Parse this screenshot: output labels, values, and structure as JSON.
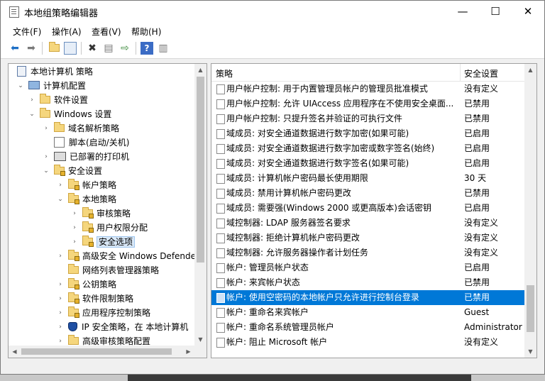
{
  "window": {
    "title": "本地组策略编辑器",
    "minimize": "—",
    "maximize": "☐",
    "close": "✕"
  },
  "menu": [
    "文件(F)",
    "操作(A)",
    "查看(V)",
    "帮助(H)"
  ],
  "toolbar": {
    "back": "back-arrow-icon",
    "forward": "forward-arrow-icon",
    "up": "up-folder-icon",
    "show_tree": "show-hide-tree-icon",
    "delete": "delete-icon",
    "properties": "properties-icon",
    "export": "export-list-icon",
    "help": "help-icon",
    "extended_view": "extended-view-icon"
  },
  "tree": [
    {
      "label": "本地计算机 策略",
      "icon": "policy",
      "expander": ""
    },
    {
      "label": "计算机配置",
      "icon": "computer",
      "expander": "⌄"
    },
    {
      "label": "软件设置",
      "icon": "folder",
      "expander": "›"
    },
    {
      "label": "Windows 设置",
      "icon": "folder",
      "expander": "⌄"
    },
    {
      "label": "域名解析策略",
      "icon": "folder",
      "expander": "›"
    },
    {
      "label": "脚本(启动/关机)",
      "icon": "script",
      "expander": ""
    },
    {
      "label": "已部署的打印机",
      "icon": "printer",
      "expander": "›"
    },
    {
      "label": "安全设置",
      "icon": "folder-secure",
      "expander": "⌄"
    },
    {
      "label": "帐户策略",
      "icon": "folder-secure",
      "expander": "›"
    },
    {
      "label": "本地策略",
      "icon": "folder-secure",
      "expander": "⌄"
    },
    {
      "label": "审核策略",
      "icon": "folder-secure",
      "expander": "›"
    },
    {
      "label": "用户权限分配",
      "icon": "folder-secure",
      "expander": "›"
    },
    {
      "label": "安全选项",
      "icon": "folder-secure",
      "expander": "›",
      "selected": true
    },
    {
      "label": "高级安全 Windows Defende",
      "icon": "folder-secure",
      "expander": "›"
    },
    {
      "label": "网络列表管理器策略",
      "icon": "folder",
      "expander": ""
    },
    {
      "label": "公钥策略",
      "icon": "folder-secure",
      "expander": "›"
    },
    {
      "label": "软件限制策略",
      "icon": "folder-secure",
      "expander": "›"
    },
    {
      "label": "应用程序控制策略",
      "icon": "folder-secure",
      "expander": "›"
    },
    {
      "label": "IP 安全策略，在 本地计算机",
      "icon": "shield",
      "expander": "›"
    },
    {
      "label": "高级审核策略配置",
      "icon": "folder",
      "expander": "›"
    }
  ],
  "list": {
    "col_policy": "策略",
    "col_setting": "安全设置",
    "rows": [
      {
        "policy": "用户帐户控制: 用于内置管理员帐户的管理员批准模式",
        "setting": "没有定义"
      },
      {
        "policy": "用户帐户控制: 允许 UIAccess 应用程序在不使用安全桌面...",
        "setting": "已禁用"
      },
      {
        "policy": "用户帐户控制: 只提升签名并验证的可执行文件",
        "setting": "已禁用"
      },
      {
        "policy": "域成员: 对安全通道数据进行数字加密(如果可能)",
        "setting": "已启用"
      },
      {
        "policy": "域成员: 对安全通道数据进行数字加密或数字签名(始终)",
        "setting": "已启用"
      },
      {
        "policy": "域成员: 对安全通道数据进行数字签名(如果可能)",
        "setting": "已启用"
      },
      {
        "policy": "域成员: 计算机帐户密码最长使用期限",
        "setting": "30 天"
      },
      {
        "policy": "域成员: 禁用计算机帐户密码更改",
        "setting": "已禁用"
      },
      {
        "policy": "域成员: 需要强(Windows 2000 或更高版本)会话密钥",
        "setting": "已启用"
      },
      {
        "policy": "域控制器: LDAP 服务器签名要求",
        "setting": "没有定义"
      },
      {
        "policy": "域控制器: 拒绝计算机帐户密码更改",
        "setting": "没有定义"
      },
      {
        "policy": "域控制器: 允许服务器操作者计划任务",
        "setting": "没有定义"
      },
      {
        "policy": "帐户: 管理员帐户状态",
        "setting": "已启用"
      },
      {
        "policy": "帐户: 来宾帐户状态",
        "setting": "已禁用"
      },
      {
        "policy": "帐户: 使用空密码的本地帐户只允许进行控制台登录",
        "setting": "已禁用",
        "selected": true
      },
      {
        "policy": "帐户: 重命名来宾帐户",
        "setting": "Guest"
      },
      {
        "policy": "帐户: 重命名系统管理员帐户",
        "setting": "Administrator"
      },
      {
        "policy": "帐户: 阻止 Microsoft 帐户",
        "setting": "没有定义"
      }
    ]
  },
  "colors": {
    "selection": "#0078d7",
    "tree_selection": "#d9e8f7",
    "folder": "#f5d67d"
  }
}
